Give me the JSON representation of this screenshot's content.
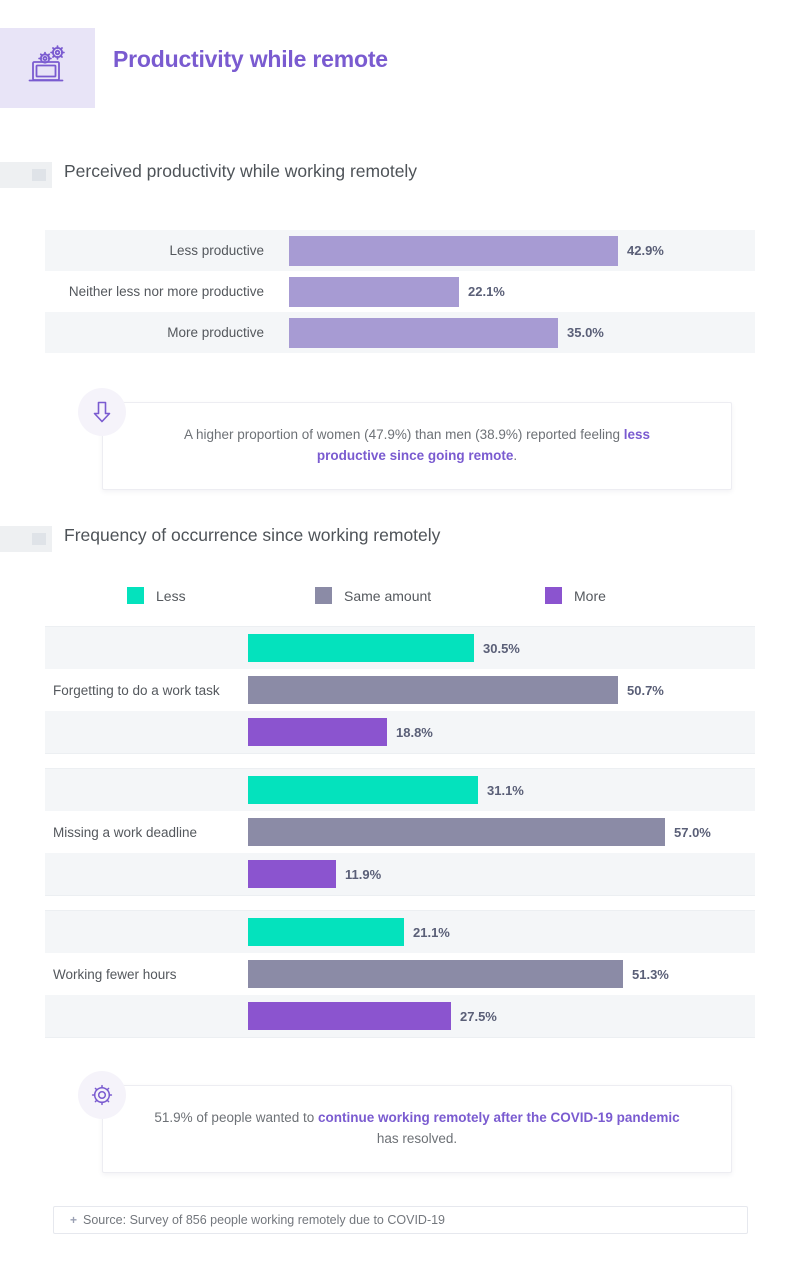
{
  "header": {
    "title": "Productivity while remote",
    "icon": "laptop-gears-icon",
    "icon_color": "#7a5bd0",
    "icon_box_color": "#e8e4f7"
  },
  "sections": [
    {
      "title": "Perceived productivity while working remotely"
    },
    {
      "title": "Frequency of occurrence since working remotely"
    }
  ],
  "callouts": [
    {
      "icon": "down-arrow-icon",
      "text_plain_1": "A higher proportion of women (47.9%) than men (38.9%) reported feeling ",
      "text_bold": "less productive since going remote",
      "text_plain_2": "."
    },
    {
      "icon": "gear-icon",
      "text_plain_1": "51.9% of people wanted to ",
      "text_bold": "continue working remotely after the COVID-19 pandemic",
      "text_plain_2": " has resolved."
    }
  ],
  "legend": [
    {
      "label": "Less",
      "color": "#04e2bd"
    },
    {
      "label": "Same amount",
      "color": "#8b8ba6"
    },
    {
      "label": "More",
      "color": "#8b54cf"
    }
  ],
  "source": {
    "plus": "+",
    "text": "Source: Survey of 856 people working remotely due to COVID-19"
  },
  "chart_data": [
    {
      "type": "bar",
      "title": "Perceived productivity while working remotely",
      "orientation": "horizontal",
      "xlabel": "",
      "ylabel": "",
      "xlim": [
        0,
        100
      ],
      "unit": "%",
      "grid": false,
      "legend": "none",
      "bar_color": "#a79bd3",
      "categories": [
        "Less productive",
        "Neither less nor more productive",
        "More productive"
      ],
      "values": [
        42.9,
        22.1,
        35.0
      ],
      "value_labels": [
        "42.9%",
        "22.1%",
        "35.0%"
      ]
    },
    {
      "type": "bar",
      "title": "Frequency of occurrence since working remotely",
      "orientation": "horizontal",
      "grouped": true,
      "xlabel": "",
      "ylabel": "",
      "xlim": [
        0,
        100
      ],
      "unit": "%",
      "grid": false,
      "legend": "top",
      "categories": [
        "Forgetting to do a work task",
        "Missing a work deadline",
        "Working fewer hours"
      ],
      "series": [
        {
          "name": "Less",
          "color": "#04e2bd",
          "values": [
            30.5,
            31.1,
            21.1
          ],
          "value_labels": [
            "30.5%",
            "31.1%",
            "21.1%"
          ]
        },
        {
          "name": "Same amount",
          "color": "#8b8ba6",
          "values": [
            50.7,
            57.0,
            51.3
          ],
          "value_labels": [
            "50.7%",
            "57.0%",
            "51.3%"
          ]
        },
        {
          "name": "More",
          "color": "#8b54cf",
          "values": [
            18.8,
            11.9,
            27.5
          ],
          "value_labels": [
            "18.8%",
            "11.9%",
            "27.5%"
          ]
        }
      ]
    }
  ]
}
